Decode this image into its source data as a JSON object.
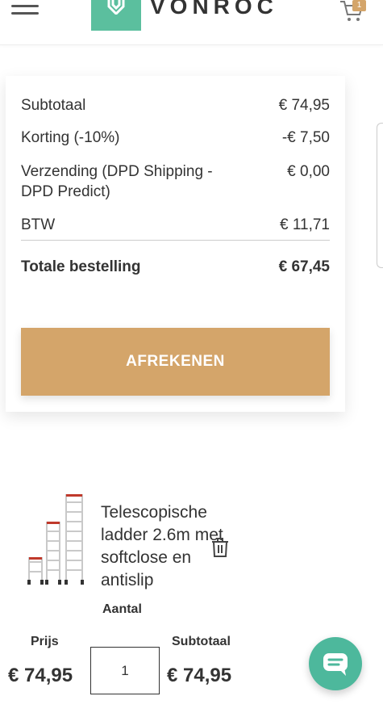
{
  "header": {
    "logo_text": "VONROC",
    "cart_count": "1",
    "brand_color": "#5bbf9e",
    "accent_color": "#d4a56a"
  },
  "summary": {
    "rows": [
      {
        "label": "Subtotaal",
        "value": "€ 74,95"
      },
      {
        "label": "Korting (-10%)",
        "value": "-€ 7,50"
      },
      {
        "label": "Verzending (DPD Shipping - DPD Predict)",
        "value": "€ 0,00"
      },
      {
        "label": "BTW",
        "value": "€ 11,71"
      }
    ],
    "total_label": "Totale bestelling",
    "total_value": "€ 67,45",
    "checkout_label": "AFREKENEN"
  },
  "product": {
    "name": "Telescopische ladder 2.6m met softclose en antislip",
    "qty_label": "Aantal",
    "price_label": "Prijs",
    "subtotal_label": "Subtotaal",
    "price": "€ 74,95",
    "quantity": "1",
    "subtotal": "€ 74,95"
  }
}
